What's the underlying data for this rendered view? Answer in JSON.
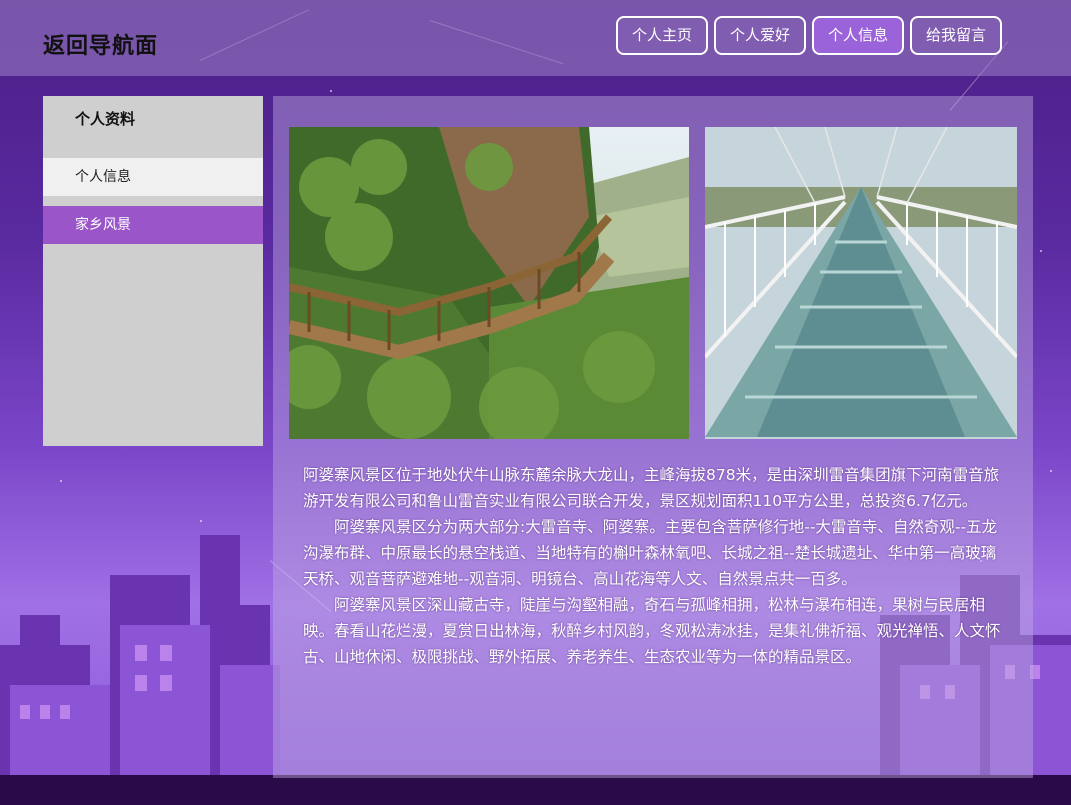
{
  "header": {
    "back_label": "返回导航面",
    "nav": [
      {
        "label": "个人主页",
        "active": false
      },
      {
        "label": "个人爱好",
        "active": false
      },
      {
        "label": "个人信息",
        "active": true
      },
      {
        "label": "给我留言",
        "active": false
      }
    ]
  },
  "sidebar": {
    "title": "个人资料",
    "items": [
      {
        "label": "个人信息"
      },
      {
        "label": "家乡风景"
      }
    ]
  },
  "main": {
    "photos": [
      {
        "icon": "mountain-plank-walkway-photo"
      },
      {
        "icon": "glass-bridge-photo"
      }
    ],
    "paragraphs": [
      "阿婆寨风景区位于地处伏牛山脉东麓余脉大龙山，主峰海拔878米，是由深圳雷音集团旗下河南雷音旅游开发有限公司和鲁山雷音实业有限公司联合开发，景区规划面积110平方公里，总投资6.7亿元。",
      "阿婆寨风景区分为两大部分:大雷音寺、阿婆寨。主要包含菩萨修行地--大雷音寺、自然奇观--五龙沟瀑布群、中原最长的悬空栈道、当地特有的槲叶森林氧吧、长城之祖--楚长城遗址、华中第一高玻璃天桥、观音菩萨避难地--观音洞、明镜台、高山花海等人文、自然景点共一百多。",
      "阿婆寨风景区深山藏古寺，陡崖与沟壑相融，奇石与孤峰相拥，松林与瀑布相连，果树与民居相映。春看山花烂漫，夏赏日出林海，秋醉乡村风韵，冬观松涛冰挂，是集礼佛祈福、观光禅悟、人文怀古、山地休闲、极限挑战、野外拓展、养老养生、生态农业等为一体的精品景区。"
    ]
  },
  "colors": {
    "active_nav": "#9b63d9",
    "sidebar_active": "#9a56c8",
    "sidebar_bg": "#cfcfcf"
  }
}
